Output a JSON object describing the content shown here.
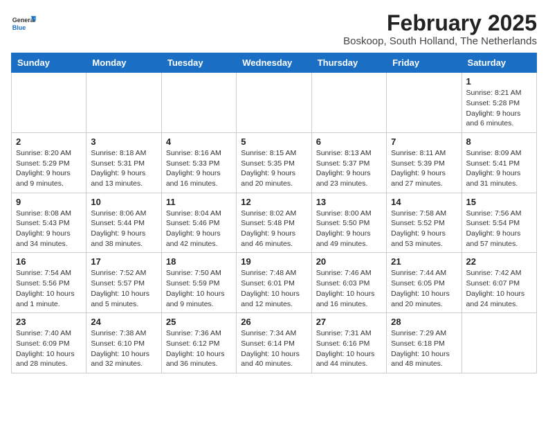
{
  "header": {
    "logo_general": "General",
    "logo_blue": "Blue",
    "month_year": "February 2025",
    "location": "Boskoop, South Holland, The Netherlands"
  },
  "weekdays": [
    "Sunday",
    "Monday",
    "Tuesday",
    "Wednesday",
    "Thursday",
    "Friday",
    "Saturday"
  ],
  "weeks": [
    [
      {
        "day": "",
        "info": ""
      },
      {
        "day": "",
        "info": ""
      },
      {
        "day": "",
        "info": ""
      },
      {
        "day": "",
        "info": ""
      },
      {
        "day": "",
        "info": ""
      },
      {
        "day": "",
        "info": ""
      },
      {
        "day": "1",
        "info": "Sunrise: 8:21 AM\nSunset: 5:28 PM\nDaylight: 9 hours and 6 minutes."
      }
    ],
    [
      {
        "day": "2",
        "info": "Sunrise: 8:20 AM\nSunset: 5:29 PM\nDaylight: 9 hours and 9 minutes."
      },
      {
        "day": "3",
        "info": "Sunrise: 8:18 AM\nSunset: 5:31 PM\nDaylight: 9 hours and 13 minutes."
      },
      {
        "day": "4",
        "info": "Sunrise: 8:16 AM\nSunset: 5:33 PM\nDaylight: 9 hours and 16 minutes."
      },
      {
        "day": "5",
        "info": "Sunrise: 8:15 AM\nSunset: 5:35 PM\nDaylight: 9 hours and 20 minutes."
      },
      {
        "day": "6",
        "info": "Sunrise: 8:13 AM\nSunset: 5:37 PM\nDaylight: 9 hours and 23 minutes."
      },
      {
        "day": "7",
        "info": "Sunrise: 8:11 AM\nSunset: 5:39 PM\nDaylight: 9 hours and 27 minutes."
      },
      {
        "day": "8",
        "info": "Sunrise: 8:09 AM\nSunset: 5:41 PM\nDaylight: 9 hours and 31 minutes."
      }
    ],
    [
      {
        "day": "9",
        "info": "Sunrise: 8:08 AM\nSunset: 5:43 PM\nDaylight: 9 hours and 34 minutes."
      },
      {
        "day": "10",
        "info": "Sunrise: 8:06 AM\nSunset: 5:44 PM\nDaylight: 9 hours and 38 minutes."
      },
      {
        "day": "11",
        "info": "Sunrise: 8:04 AM\nSunset: 5:46 PM\nDaylight: 9 hours and 42 minutes."
      },
      {
        "day": "12",
        "info": "Sunrise: 8:02 AM\nSunset: 5:48 PM\nDaylight: 9 hours and 46 minutes."
      },
      {
        "day": "13",
        "info": "Sunrise: 8:00 AM\nSunset: 5:50 PM\nDaylight: 9 hours and 49 minutes."
      },
      {
        "day": "14",
        "info": "Sunrise: 7:58 AM\nSunset: 5:52 PM\nDaylight: 9 hours and 53 minutes."
      },
      {
        "day": "15",
        "info": "Sunrise: 7:56 AM\nSunset: 5:54 PM\nDaylight: 9 hours and 57 minutes."
      }
    ],
    [
      {
        "day": "16",
        "info": "Sunrise: 7:54 AM\nSunset: 5:56 PM\nDaylight: 10 hours and 1 minute."
      },
      {
        "day": "17",
        "info": "Sunrise: 7:52 AM\nSunset: 5:57 PM\nDaylight: 10 hours and 5 minutes."
      },
      {
        "day": "18",
        "info": "Sunrise: 7:50 AM\nSunset: 5:59 PM\nDaylight: 10 hours and 9 minutes."
      },
      {
        "day": "19",
        "info": "Sunrise: 7:48 AM\nSunset: 6:01 PM\nDaylight: 10 hours and 12 minutes."
      },
      {
        "day": "20",
        "info": "Sunrise: 7:46 AM\nSunset: 6:03 PM\nDaylight: 10 hours and 16 minutes."
      },
      {
        "day": "21",
        "info": "Sunrise: 7:44 AM\nSunset: 6:05 PM\nDaylight: 10 hours and 20 minutes."
      },
      {
        "day": "22",
        "info": "Sunrise: 7:42 AM\nSunset: 6:07 PM\nDaylight: 10 hours and 24 minutes."
      }
    ],
    [
      {
        "day": "23",
        "info": "Sunrise: 7:40 AM\nSunset: 6:09 PM\nDaylight: 10 hours and 28 minutes."
      },
      {
        "day": "24",
        "info": "Sunrise: 7:38 AM\nSunset: 6:10 PM\nDaylight: 10 hours and 32 minutes."
      },
      {
        "day": "25",
        "info": "Sunrise: 7:36 AM\nSunset: 6:12 PM\nDaylight: 10 hours and 36 minutes."
      },
      {
        "day": "26",
        "info": "Sunrise: 7:34 AM\nSunset: 6:14 PM\nDaylight: 10 hours and 40 minutes."
      },
      {
        "day": "27",
        "info": "Sunrise: 7:31 AM\nSunset: 6:16 PM\nDaylight: 10 hours and 44 minutes."
      },
      {
        "day": "28",
        "info": "Sunrise: 7:29 AM\nSunset: 6:18 PM\nDaylight: 10 hours and 48 minutes."
      },
      {
        "day": "",
        "info": ""
      }
    ]
  ]
}
